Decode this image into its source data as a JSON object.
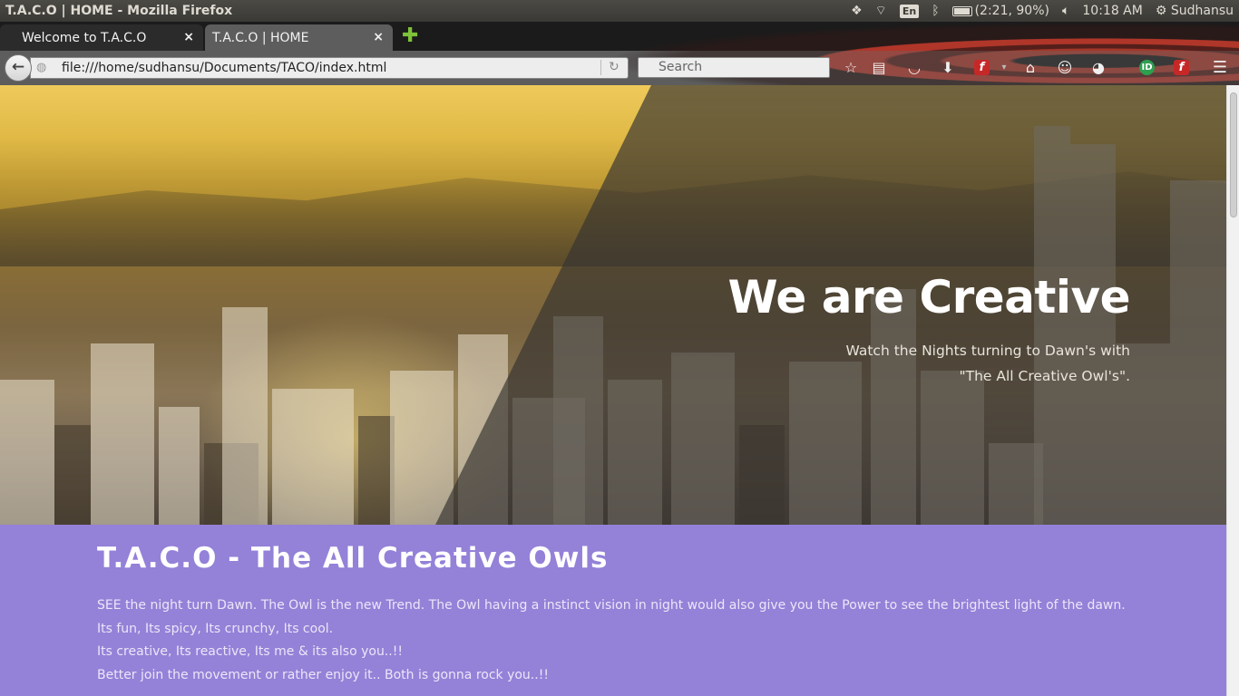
{
  "os_panel": {
    "window_title": "T.A.C.O | HOME - Mozilla Firefox",
    "keyboard_layout": "En",
    "battery": "(2:21, 90%)",
    "clock": "10:18 AM",
    "user": "Sudhansu"
  },
  "browser": {
    "tabs": [
      {
        "label": "Welcome to T.A.C.O",
        "close": "×",
        "active": false
      },
      {
        "label": "T.A.C.O | HOME",
        "close": "×",
        "active": true
      }
    ],
    "new_tab": "✚",
    "url": "file:///home/sudhansu/Documents/TACO/index.html",
    "search_placeholder": "Search",
    "toolbar_icons": [
      "bookmark-star-icon",
      "reading-list-icon",
      "pocket-icon",
      "downloads-icon",
      "flash-icon",
      "home-icon",
      "chat-icon",
      "extension-icon",
      "extension-green-icon",
      "flash-icon",
      "menu-icon"
    ]
  },
  "hero": {
    "headline": "We are Creative",
    "tagline": "Watch the Nights turning to Dawn's with \"The All Creative Owl's\"."
  },
  "about": {
    "title": "T.A.C.O - The All Creative Owls",
    "lines": [
      "SEE the night turn Dawn. The Owl is the new Trend. The Owl having a instinct vision in night would also give you the Power to see the brightest light of the dawn.",
      "Its fun, Its spicy, Its crunchy, Its cool.",
      "Its creative, Its reactive, Its me & its also you..!!",
      "Better join the movement or rather enjoy it.. Both is gonna rock you..!!"
    ]
  },
  "colors": {
    "about_bg": "#9481d8",
    "hero_overlay": "#37342f"
  }
}
